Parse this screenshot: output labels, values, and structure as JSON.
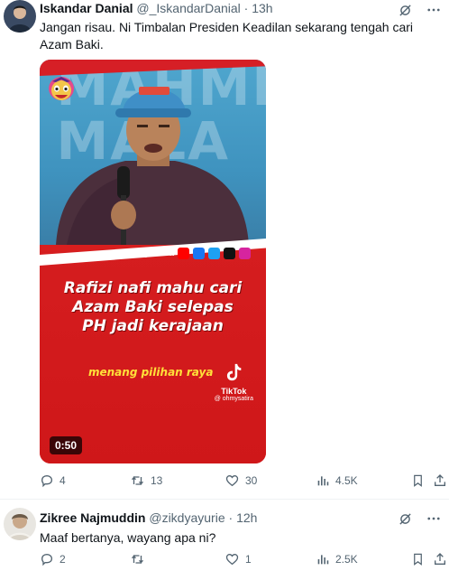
{
  "posts": [
    {
      "author_name": "Iskandar Danial",
      "handle": "@_IskandarDanial",
      "separator": "·",
      "time": "13h",
      "text": "Jangan risau. Ni Timbalan Presiden Keadilan sekarang tengah cari Azam Baki.",
      "video": {
        "brand": "ohmysatira",
        "headline_lines": [
          "Rafizi nafi mahu cari",
          "Azam Baki selepas",
          "PH jadi kerajaan"
        ],
        "subline": "menang pilihan raya",
        "tiktok_label": "TikTok",
        "tiktok_handle": "@ ohmysatira",
        "duration": "0:50",
        "bg_letters": "MAHMI\nMALA"
      },
      "actions": {
        "replies": "4",
        "reposts": "13",
        "likes": "30",
        "views": "4.5K"
      }
    },
    {
      "author_name": "Zikree Najmuddin",
      "handle": "@zikdyayurie",
      "separator": "·",
      "time": "12h",
      "text": "Maaf bertanya, wayang apa ni?",
      "actions": {
        "replies": "2",
        "reposts": "",
        "likes": "1",
        "views": "2.5K"
      }
    }
  ],
  "icons": [
    "grok-icon",
    "more-icon",
    "reply-icon",
    "repost-icon",
    "like-icon",
    "views-icon",
    "bookmark-icon",
    "share-icon"
  ],
  "colors": {
    "text": "#0f1419",
    "muted": "#536471",
    "video_red": "#d51d1f",
    "divider": "#eff3f4"
  }
}
